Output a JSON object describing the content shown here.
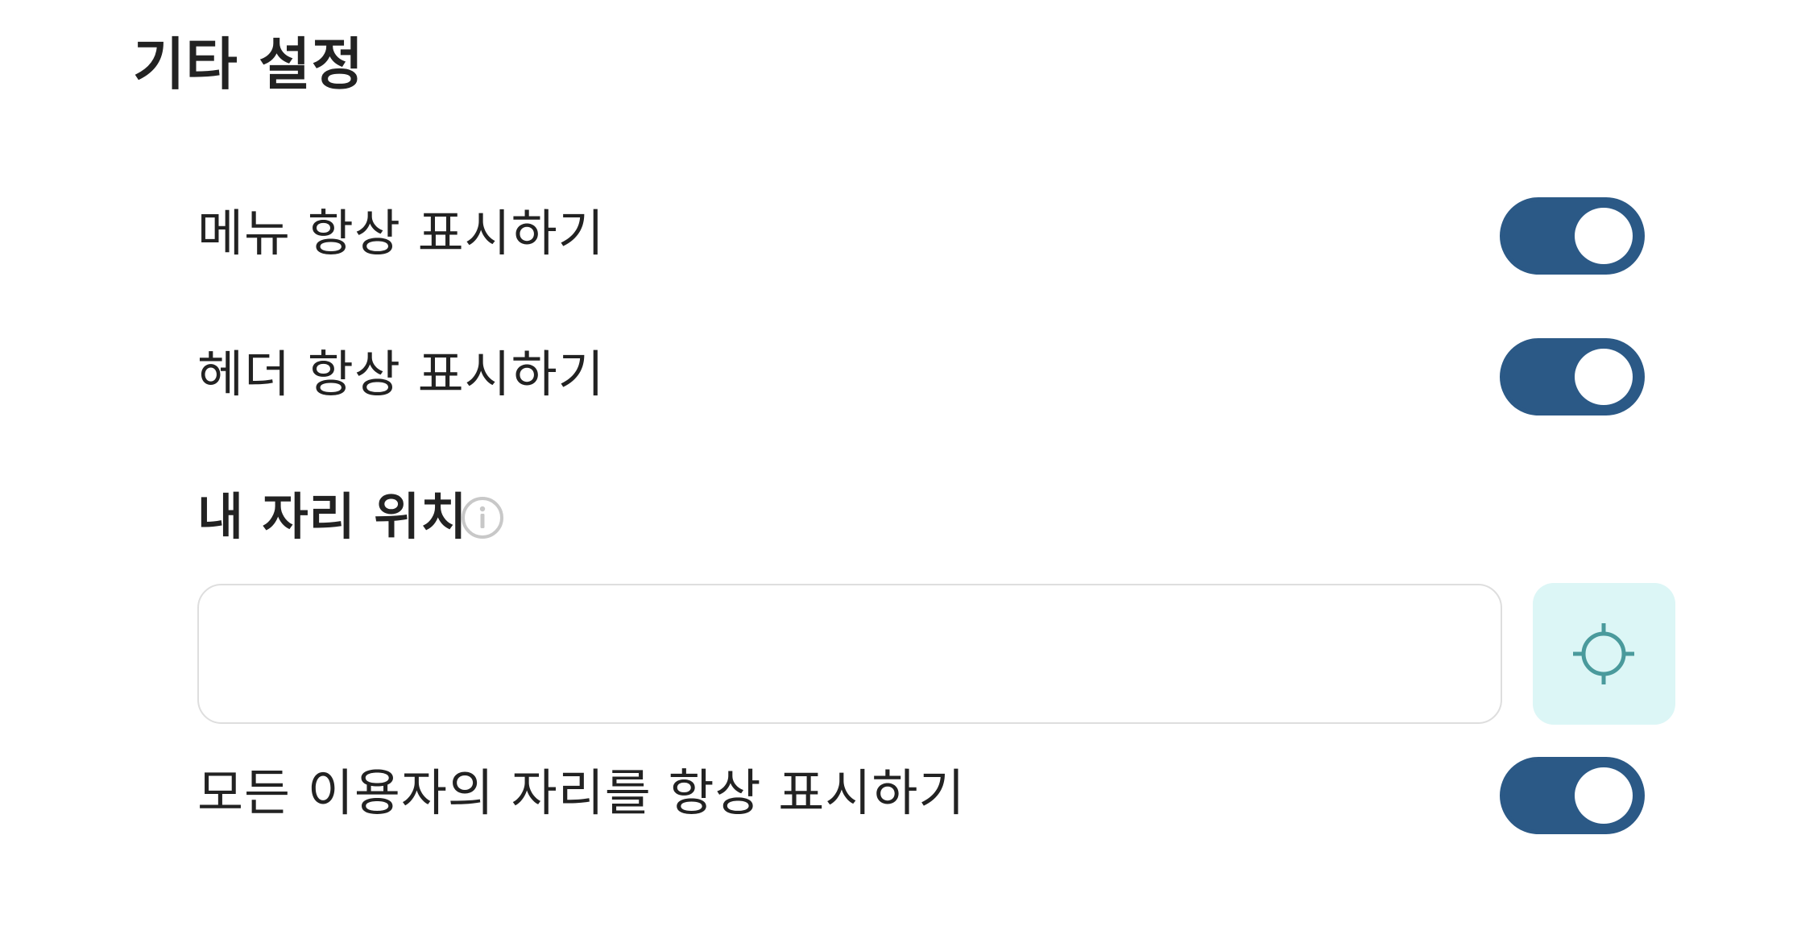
{
  "section": {
    "title": "기타 설정"
  },
  "settings": {
    "always_show_menu": {
      "label": "메뉴 항상 표시하기",
      "enabled": true
    },
    "always_show_header": {
      "label": "헤더 항상 표시하기",
      "enabled": true
    },
    "my_seat_location": {
      "label": "내 자리 위치",
      "info_icon": "info-icon",
      "value": "",
      "placeholder": "",
      "locate_icon": "crosshair-icon"
    },
    "always_show_all_seats": {
      "label": "모든 이용자의 자리를 항상 표시하기",
      "enabled": true
    }
  },
  "colors": {
    "toggle_on": "#2b5986",
    "locate_button_bg": "#dcf6f6",
    "locate_icon": "#4a9a9c",
    "info_icon": "#c8c8c8",
    "input_border": "#dedede"
  }
}
